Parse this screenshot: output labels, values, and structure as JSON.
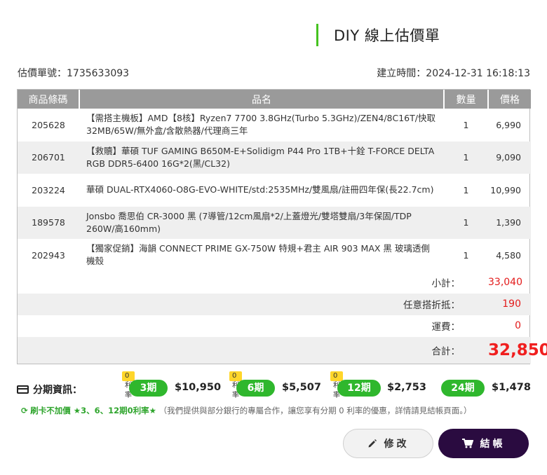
{
  "header": {
    "title": "DIY 線上估價單"
  },
  "meta": {
    "quote_no": "估價單號：1735633093",
    "created": "建立時間：2024-12-31 16:18:13"
  },
  "table": {
    "headers": [
      "商品條碼",
      "品名",
      "數量",
      "價格"
    ],
    "rows": [
      {
        "code": "205628",
        "name": "【需搭主機板】AMD【8核】Ryzen7 7700 3.8GHz(Turbo 5.3GHz)/ZEN4/8C16T/快取32MB/65W/無外盒/含散熱器/代理商三年",
        "qty": "1",
        "price": "6,990"
      },
      {
        "code": "206701",
        "name": "【救贖】華碩 TUF GAMING B650M-E+Solidigm P44 Pro 1TB+十銓 T-FORCE DELTA RGB DDR5-6400 16G*2(黑/CL32)",
        "qty": "1",
        "price": "9,090"
      },
      {
        "code": "203224",
        "name": "華碩 DUAL-RTX4060-O8G-EVO-WHITE/std:2535MHz/雙風扇/註冊四年保(長22.7cm)",
        "qty": "1",
        "price": "10,990"
      },
      {
        "code": "189578",
        "name": "Jonsbo 喬思伯 CR-3000 黑 (7導管/12cm風扇*2/上蓋燈光/雙塔雙扇/3年保固/TDP 260W/高160mm)",
        "qty": "1",
        "price": "1,390"
      },
      {
        "code": "202943",
        "name": "【獨家促銷】海韻 CONNECT PRIME GX-750W 特規+君主 AIR 903 MAX 黑 玻璃透側機殼",
        "qty": "1",
        "price": "4,580"
      }
    ],
    "summary": {
      "subtotal_label": "小計：",
      "subtotal": "33,040",
      "discount_label": "任意搭折抵：",
      "discount": "190",
      "shipping_label": "運費：",
      "shipping": "0",
      "total_label": "合計：",
      "total": "32,850"
    }
  },
  "installment": {
    "label": "分期資訊：",
    "zero_badge": "0利率",
    "plans": [
      {
        "term": "3期",
        "amount": "$10,950",
        "zero_rate": true
      },
      {
        "term": "6期",
        "amount": "$5,507",
        "zero_rate": true
      },
      {
        "term": "12期",
        "amount": "$2,753",
        "zero_rate": true
      },
      {
        "term": "24期",
        "amount": "$1,478",
        "zero_rate": false
      }
    ]
  },
  "note": {
    "highlight": "刷卡不加價 ★3、6、12期0利率★",
    "text": "（我們提供與部分銀行的專屬合作，讓您享有分期 0 利率的優惠，詳情請見結帳頁面。）"
  },
  "buttons": {
    "edit": "修改",
    "checkout": "結帳"
  },
  "colors": {
    "accent_green": "#2fb72d",
    "title_bar": "#45c21f",
    "total_red": "#f01f1f",
    "checkout_bg": "#2a0b40",
    "zero_badge": "#ffd62a"
  },
  "icons": {
    "installment": "credit-card-icon",
    "note": "refresh-icon",
    "edit": "pencil-icon",
    "checkout": "cart-icon"
  }
}
